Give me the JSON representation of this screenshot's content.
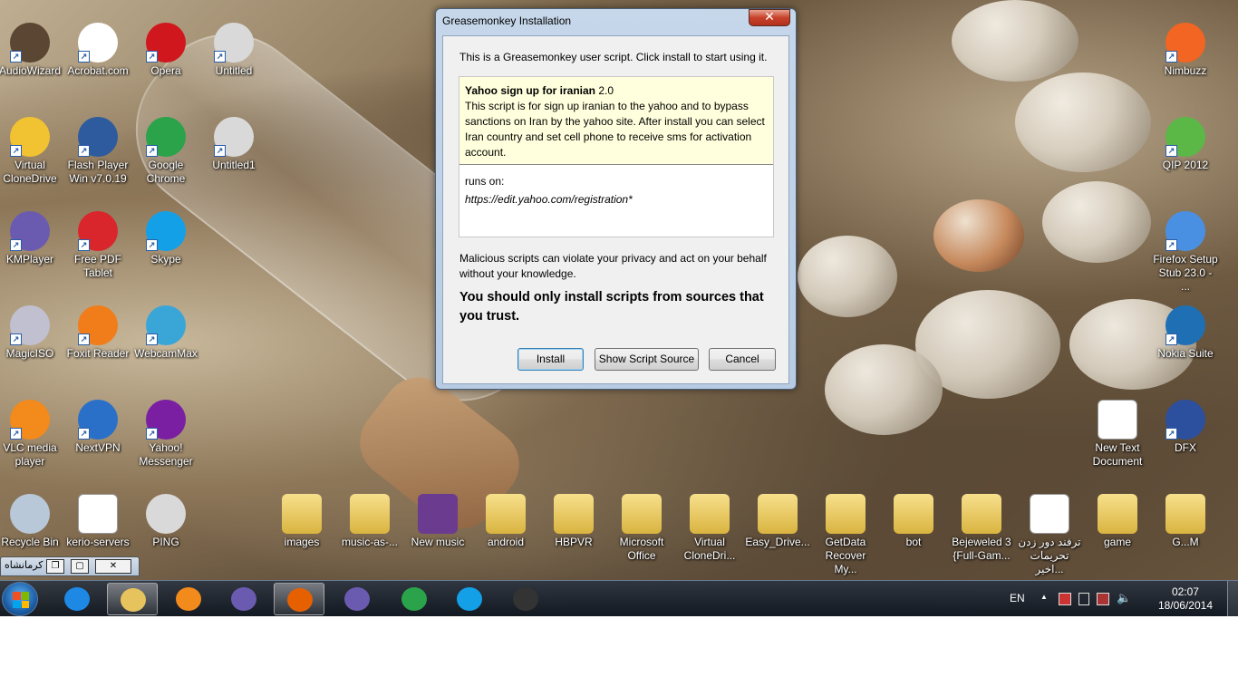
{
  "desktop_icons": [
    {
      "label": "AudioWizard",
      "icon": "speaker-icon",
      "color": "#5a4633"
    },
    {
      "label": "Acrobat.com",
      "icon": "acrobat-icon",
      "color": "#ffffff"
    },
    {
      "label": "Opera",
      "icon": "opera-icon",
      "color": "#d0171e"
    },
    {
      "label": "Untitled",
      "icon": "window-icon",
      "color": "#d9d9d9"
    },
    {
      "label": "Virtual CloneDrive",
      "icon": "sheep-icon",
      "color": "#f1c232"
    },
    {
      "label": "Flash Player Win v7.0.19",
      "icon": "flash-icon",
      "color": "#2d5b9e"
    },
    {
      "label": "Google Chrome",
      "icon": "chrome-icon",
      "color": "#2aa34a"
    },
    {
      "label": "Untitled1",
      "icon": "window-icon",
      "color": "#d9d9d9"
    },
    {
      "label": "KMPlayer",
      "icon": "kmplayer-icon",
      "color": "#6b5bb0"
    },
    {
      "label": "Free PDF Tablet",
      "icon": "pdf-icon",
      "color": "#d9262c"
    },
    {
      "label": "Skype",
      "icon": "skype-icon",
      "color": "#13a0e6"
    },
    {
      "label": "MagicISO",
      "icon": "disc-icon",
      "color": "#c0c0d0"
    },
    {
      "label": "Foxit Reader",
      "icon": "foxit-icon",
      "color": "#f07d1a"
    },
    {
      "label": "WebcamMax",
      "icon": "webcam-icon",
      "color": "#3aa6d8"
    },
    {
      "label": "VLC media player",
      "icon": "vlc-icon",
      "color": "#f28a1c"
    },
    {
      "label": "NextVPN",
      "icon": "globe-icon",
      "color": "#2a70c8"
    },
    {
      "label": "Yahoo! Messenger",
      "icon": "yahoo-icon",
      "color": "#7b1fa2"
    },
    {
      "label": "Nimbuzz",
      "icon": "nimbuzz-icon",
      "color": "#f26522"
    },
    {
      "label": "QIP 2012",
      "icon": "qip-icon",
      "color": "#5bb846"
    },
    {
      "label": "Firefox Setup Stub 23.0 - ...",
      "icon": "installer-icon",
      "color": "#4a90e2"
    },
    {
      "label": "Nokia Suite",
      "icon": "nokia-icon",
      "color": "#1f6fb5"
    },
    {
      "label": "New Text Document",
      "icon": "text-document-icon",
      "color": "#ffffff"
    },
    {
      "label": "DFX",
      "icon": "dfx-icon",
      "color": "#2c4f9e"
    },
    {
      "label": "Recycle Bin",
      "icon": "recycle-bin-icon",
      "color": "#b8c8d8"
    },
    {
      "label": "kerio-servers",
      "icon": "text-document-icon",
      "color": "#ffffff"
    },
    {
      "label": "PING",
      "icon": "window-icon",
      "color": "#d9d9d9"
    },
    {
      "label": "images",
      "icon": "folder-icon",
      "color": "#e6c35c"
    },
    {
      "label": "music-as-...",
      "icon": "folder-icon",
      "color": "#e6c35c"
    },
    {
      "label": "New music",
      "icon": "folder-icon",
      "color": "#6a3b8f"
    },
    {
      "label": "android",
      "icon": "folder-icon",
      "color": "#e6c35c"
    },
    {
      "label": "HBPVR",
      "icon": "folder-icon",
      "color": "#e6c35c"
    },
    {
      "label": "Microsoft Office",
      "icon": "folder-icon",
      "color": "#e6c35c"
    },
    {
      "label": "Virtual CloneDri...",
      "icon": "folder-icon",
      "color": "#e6c35c"
    },
    {
      "label": "Easy_Drive...",
      "icon": "folder-icon",
      "color": "#e6c35c"
    },
    {
      "label": "GetData Recover My...",
      "icon": "folder-icon",
      "color": "#e6c35c"
    },
    {
      "label": "bot",
      "icon": "folder-icon",
      "color": "#e6c35c"
    },
    {
      "label": "Bejeweled 3 {Full-Gam...",
      "icon": "folder-icon",
      "color": "#e6c35c"
    },
    {
      "label": "ترفند دور زدن تحریمات اخیر...",
      "icon": "text-document-icon",
      "color": "#ffffff"
    },
    {
      "label": "game",
      "icon": "folder-icon",
      "color": "#e6c35c"
    },
    {
      "label": "G...M",
      "icon": "folder-icon",
      "color": "#e6c35c"
    }
  ],
  "dialog": {
    "title": "Greasemonkey Installation",
    "close_label": "✕",
    "intro": "This is a Greasemonkey user script. Click install to start using it.",
    "script_name": "Yahoo sign up for iranian",
    "script_version": "2.0",
    "script_description": "This script is for sign up iranian to the yahoo and to bypass sanctions on Iran by the yahoo site. After install you can select Iran country and set cell phone to receive sms for activation account.",
    "runs_on_label": "runs on:",
    "runs_on_url": "https://edit.yahoo.com/registration*",
    "warning": "Malicious scripts can violate your privacy and act on your behalf without your knowledge.",
    "strong_warning": "You should only install scripts from sources that you trust.",
    "install_label": "Install",
    "show_source_label": "Show Script Source",
    "cancel_label": "Cancel"
  },
  "mini_window": {
    "title": "کرمانشاه",
    "restore": "❐",
    "maximize": "▢",
    "close": "✕"
  },
  "taskbar": {
    "pinned": [
      {
        "name": "internet-explorer-icon",
        "color": "#1e88e5"
      },
      {
        "name": "file-explorer-icon",
        "color": "#e6c35c"
      },
      {
        "name": "media-player-icon",
        "color": "#f28a1c"
      },
      {
        "name": "kmplayer-icon",
        "color": "#6b5bb0"
      },
      {
        "name": "firefox-icon",
        "color": "#e66000"
      },
      {
        "name": "kmplayer-icon",
        "color": "#6b5bb0"
      },
      {
        "name": "chrome-icon",
        "color": "#2aa34a"
      },
      {
        "name": "skype-icon",
        "color": "#13a0e6"
      },
      {
        "name": "traffic-light-icon",
        "color": "#333333"
      }
    ],
    "language": "EN",
    "tray_arrow": "▲",
    "time": "02:07",
    "date": "18/06/2014"
  }
}
